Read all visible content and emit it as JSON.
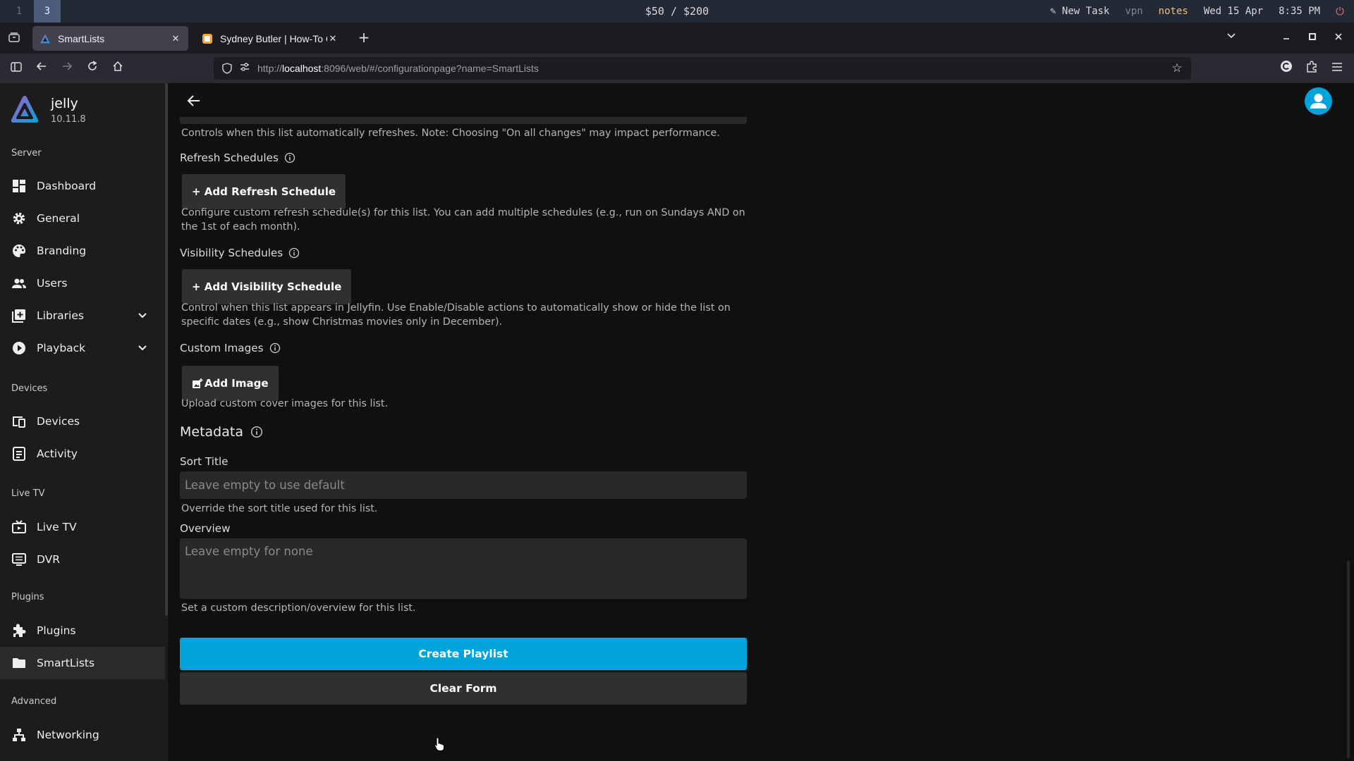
{
  "os_bar": {
    "workspace_inactive": "1",
    "workspace_active": "3",
    "budget": "$50 / $200",
    "new_task": "New Task",
    "vpn": "vpn",
    "notes": "notes",
    "date": "Wed 15 Apr",
    "time": "8:35 PM"
  },
  "browser": {
    "tabs": [
      {
        "title": "SmartLists",
        "active": true
      },
      {
        "title": "Sydney Butler | How-To Ge",
        "active": false
      }
    ],
    "url_prefix": "http://",
    "url_host": "localhost",
    "url_rest": ":8096/web/#/configurationpage?name=SmartLists"
  },
  "sidebar": {
    "app_name": "jelly",
    "version": "10.11.8",
    "sections": {
      "server": "Server",
      "devices": "Devices",
      "live_tv": "Live TV",
      "plugins": "Plugins",
      "advanced": "Advanced"
    },
    "items": {
      "dashboard": "Dashboard",
      "general": "General",
      "branding": "Branding",
      "users": "Users",
      "libraries": "Libraries",
      "playback": "Playback",
      "devices": "Devices",
      "activity": "Activity",
      "live_tv": "Live TV",
      "dvr": "DVR",
      "plugins": "Plugins",
      "smartlists": "SmartLists",
      "networking": "Networking"
    },
    "selected": "smartlists"
  },
  "form": {
    "auto_refresh_help": "Controls when this list automatically refreshes. Note: Choosing \"On all changes\" may impact performance.",
    "refresh_schedules_label": "Refresh Schedules",
    "add_refresh_schedule": "+ Add Refresh Schedule",
    "refresh_schedules_help": "Configure custom refresh schedule(s) for this list. You can add multiple schedules (e.g., run on Sundays AND on the 1st of each month).",
    "visibility_schedules_label": "Visibility Schedules",
    "add_visibility_schedule": "+ Add Visibility Schedule",
    "visibility_schedules_help": "Control when this list appears in Jellyfin. Use Enable/Disable actions to automatically show or hide the list on specific dates (e.g., show Christmas movies only in December).",
    "custom_images_label": "Custom Images",
    "add_image": "Add Image",
    "custom_images_help": "Upload custom cover images for this list.",
    "metadata_heading": "Metadata",
    "sort_title_label": "Sort Title",
    "sort_title_placeholder": "Leave empty to use default",
    "sort_title_help": "Override the sort title used for this list.",
    "overview_label": "Overview",
    "overview_placeholder": "Leave empty for none",
    "overview_help": "Set a custom description/overview for this list.",
    "create_button": "Create Playlist",
    "clear_button": "Clear Form"
  },
  "colors": {
    "accent": "#00a4dc",
    "sidebar_bg": "#1c1c1c",
    "page_bg": "#101010",
    "button_bg": "#303030",
    "input_bg": "#292929"
  }
}
